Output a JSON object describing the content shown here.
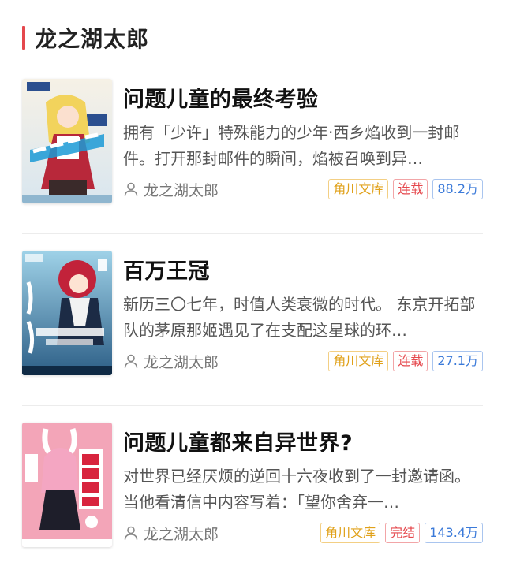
{
  "section": {
    "title": "龙之湖太郎"
  },
  "books": [
    {
      "title": "问题儿童的最终考验",
      "description": "拥有「少许」特殊能力的少年·西乡焰收到一封邮件。打开那封邮件的瞬间，焰被召唤到异…",
      "author": "龙之湖太郎",
      "publisher": "角川文库",
      "status": "连载",
      "count": "88.2万",
      "cover_icon": "light-novel-cover"
    },
    {
      "title": "百万王冠",
      "description": "新历三〇七年，时值人类衰微的时代。 东京开拓部队的茅原那姬遇见了在支配这星球的环…",
      "author": "龙之湖太郎",
      "publisher": "角川文库",
      "status": "连载",
      "count": "27.1万",
      "cover_icon": "light-novel-cover"
    },
    {
      "title": "问题儿童都来自异世界?",
      "description": "对世界已经厌烦的逆回十六夜收到了一封邀请函。 当他看清信中内容写着：「望你舍弃一…",
      "author": "龙之湖太郎",
      "publisher": "角川文库",
      "status": "完结",
      "count": "143.4万",
      "cover_icon": "light-novel-cover"
    }
  ],
  "colors": {
    "accent": "#e5484d",
    "publisher_tag": "#e0a11a",
    "status_tag": "#e5484d",
    "count_tag": "#3b7ad9"
  }
}
